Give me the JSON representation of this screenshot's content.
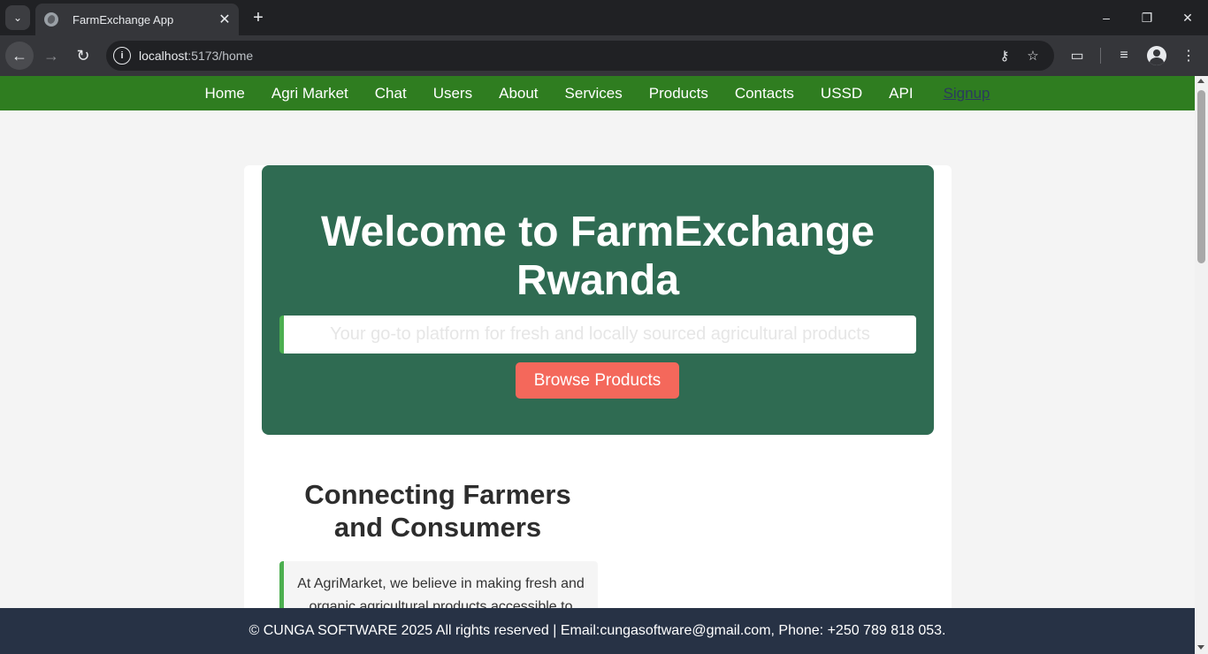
{
  "browser": {
    "tab_title": "FarmExchange App",
    "url_host": "localhost",
    "url_path": ":5173/home",
    "icons": {
      "tab_menu": "chevron-down-icon",
      "tab_close": "close-icon",
      "new_tab": "plus-icon",
      "minimize": "minimize-icon",
      "restore": "restore-icon",
      "close_window": "close-icon",
      "back": "back-arrow-icon",
      "forward": "forward-arrow-icon",
      "reload": "reload-icon",
      "site_info": "info-icon",
      "password": "key-icon",
      "bookmark": "star-icon",
      "extensions": "puzzle-icon",
      "media": "media-control-icon",
      "profile": "profile-icon",
      "menu": "kebab-menu-icon"
    }
  },
  "nav": {
    "items": [
      "Home",
      "Agri Market",
      "Chat",
      "Users",
      "About",
      "Services",
      "Products",
      "Contacts",
      "USSD",
      "API"
    ],
    "signup": "Signup"
  },
  "hero": {
    "title": "Welcome to FarmExchange Rwanda",
    "tagline": "Your go-to platform for fresh and locally sourced agricultural products",
    "button": "Browse Products"
  },
  "section": {
    "title": "Connecting Farmers and Consumers",
    "text": "At AgriMarket, we believe in making fresh and organic agricultural products accessible to"
  },
  "footer": {
    "text": "© CUNGA SOFTWARE 2025 All rights reserved | Email:cungasoftware@gmail.com, Phone: +250 789 818 053."
  },
  "colors": {
    "nav_bg": "#2f7d20",
    "hero_bg": "#2f6b52",
    "button_bg": "#f4685b",
    "accent": "#4caf50",
    "footer_bg": "#273245",
    "signup_link": "#2b3a5e"
  }
}
